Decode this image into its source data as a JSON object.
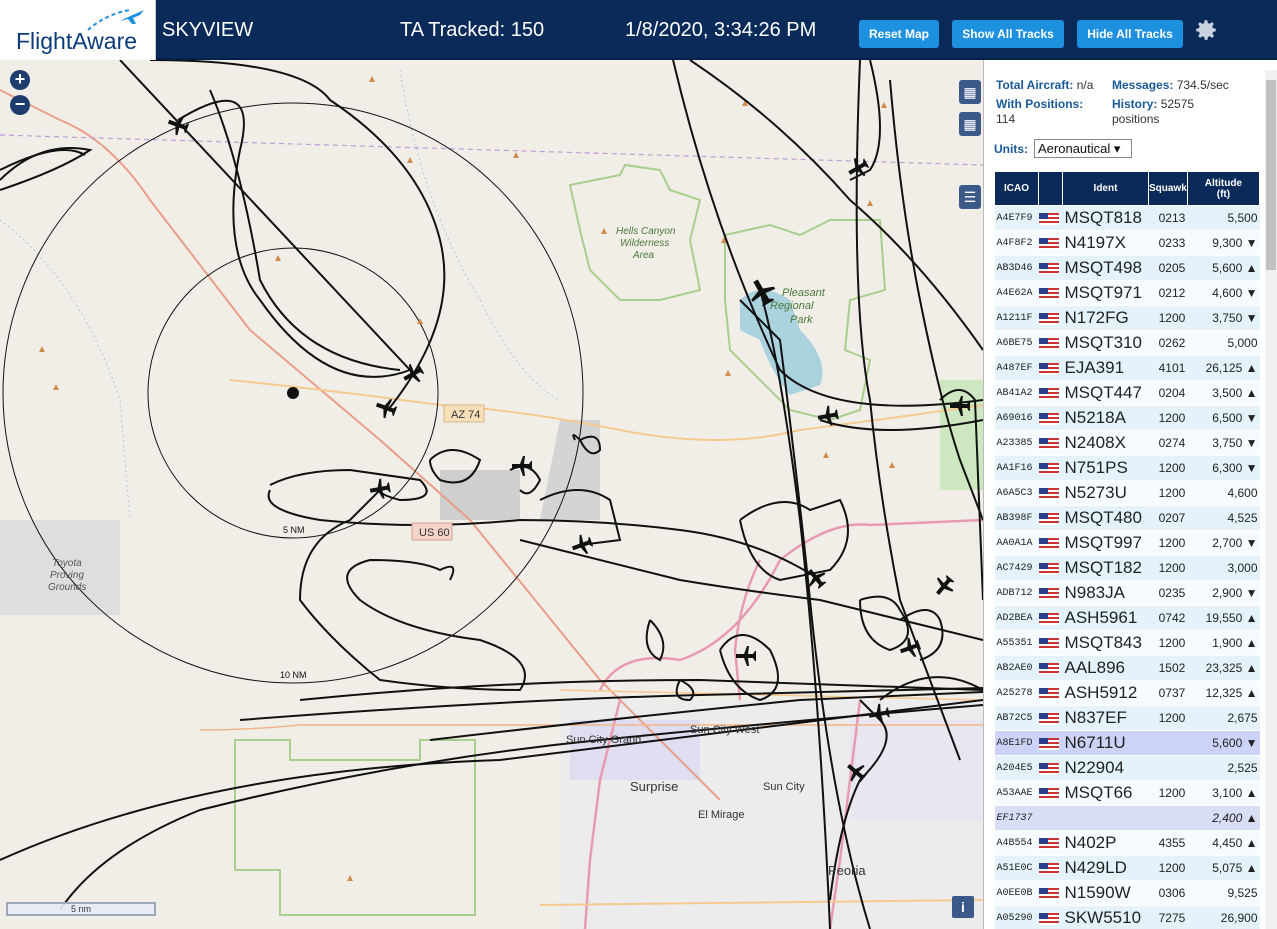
{
  "header": {
    "brand": "FlightAware",
    "app": "SKYVIEW",
    "tracked": "TA Tracked: 150",
    "datetime": "1/8/2020, 3:34:26 PM",
    "buttons": {
      "reset": "Reset Map",
      "show": "Show All Tracks",
      "hide": "Hide All Tracks"
    },
    "settings_icon": "gear-icon"
  },
  "map": {
    "labels": {
      "hells": "Hells Canyon",
      "wilderness": "Wilderness",
      "area": "Area",
      "pleasant": "Pleasant",
      "regional": "Regional",
      "park": "Park",
      "az74": "AZ 74",
      "us60": "US 60",
      "toyota": "Toyota",
      "proving": "Proving",
      "grounds": "Grounds",
      "suncitygrand": "Sun City Grand",
      "suncitywest": "Sun City West",
      "suncity": "Sun City",
      "surprise": "Surprise",
      "elmirage": "El Mirage",
      "peoria": "Peoria",
      "nm5": "5 NM",
      "nm10": "10 NM"
    },
    "scale": "5 nm",
    "zoom_in": "+",
    "zoom_out": "−",
    "info": "i"
  },
  "panel": {
    "total_label": "Total Aircraft:",
    "total_value": "n/a",
    "msg_label": "Messages:",
    "msg_value": "734.5/sec",
    "withpos_label": "With Positions:",
    "withpos_value": "114",
    "history_label": "History:",
    "history_value": "52575",
    "history_unit": "positions",
    "units_label": "Units:",
    "units_value": "Aeronautical ▾",
    "columns": {
      "icao": "ICAO",
      "ident": "Ident",
      "squawk": "Squawk",
      "alt1": "Altitude",
      "alt2": "(ft)"
    },
    "rows": [
      {
        "icao": "A4E7F9",
        "ident": "MSQT818",
        "sq": "0213",
        "alt": "5,500"
      },
      {
        "icao": "A4F8F2",
        "ident": "N4197X",
        "sq": "0233",
        "alt": "9,300 ▼"
      },
      {
        "icao": "AB3D46",
        "ident": "MSQT498",
        "sq": "0205",
        "alt": "5,600 ▲"
      },
      {
        "icao": "A4E62A",
        "ident": "MSQT971",
        "sq": "0212",
        "alt": "4,600 ▼"
      },
      {
        "icao": "A1211F",
        "ident": "N172FG",
        "sq": "1200",
        "alt": "3,750 ▼"
      },
      {
        "icao": "A6BE75",
        "ident": "MSQT310",
        "sq": "0262",
        "alt": "5,000"
      },
      {
        "icao": "A487EF",
        "ident": "EJA391",
        "sq": "4101",
        "alt": "26,125 ▲"
      },
      {
        "icao": "AB41A2",
        "ident": "MSQT447",
        "sq": "0204",
        "alt": "3,500 ▲"
      },
      {
        "icao": "A69016",
        "ident": "N5218A",
        "sq": "1200",
        "alt": "6,500 ▼"
      },
      {
        "icao": "A23385",
        "ident": "N2408X",
        "sq": "0274",
        "alt": "3,750 ▼"
      },
      {
        "icao": "AA1F16",
        "ident": "N751PS",
        "sq": "1200",
        "alt": "6,300 ▼"
      },
      {
        "icao": "A6A5C3",
        "ident": "N5273U",
        "sq": "1200",
        "alt": "4,600"
      },
      {
        "icao": "AB398F",
        "ident": "MSQT480",
        "sq": "0207",
        "alt": "4,525"
      },
      {
        "icao": "AA0A1A",
        "ident": "MSQT997",
        "sq": "1200",
        "alt": "2,700 ▼"
      },
      {
        "icao": "AC7429",
        "ident": "MSQT182",
        "sq": "1200",
        "alt": "3,000"
      },
      {
        "icao": "ADB712",
        "ident": "N983JA",
        "sq": "0235",
        "alt": "2,900 ▼"
      },
      {
        "icao": "AD2BEA",
        "ident": "ASH5961",
        "sq": "0742",
        "alt": "19,550 ▲"
      },
      {
        "icao": "A55351",
        "ident": "MSQT843",
        "sq": "1200",
        "alt": "1,900 ▲"
      },
      {
        "icao": "AB2AE0",
        "ident": "AAL896",
        "sq": "1502",
        "alt": "23,325 ▲"
      },
      {
        "icao": "A25278",
        "ident": "ASH5912",
        "sq": "0737",
        "alt": "12,325 ▲"
      },
      {
        "icao": "AB72C5",
        "ident": "N837EF",
        "sq": "1200",
        "alt": "2,675"
      },
      {
        "icao": "A8E1FD",
        "ident": "N6711U",
        "sq": "",
        "alt": "5,600 ▼",
        "sel": true
      },
      {
        "icao": "A204E5",
        "ident": "N22904",
        "sq": "",
        "alt": "2,525"
      },
      {
        "icao": "A53AAE",
        "ident": "MSQT66",
        "sq": "1200",
        "alt": "3,100 ▲"
      },
      {
        "icao": "EF1737",
        "ident": "",
        "sq": "",
        "alt": "2,400 ▲",
        "grey": true,
        "noflag": true
      },
      {
        "icao": "A4B554",
        "ident": "N402P",
        "sq": "4355",
        "alt": "4,450 ▲"
      },
      {
        "icao": "A51E0C",
        "ident": "N429LD",
        "sq": "1200",
        "alt": "5,075 ▲"
      },
      {
        "icao": "A0EE0B",
        "ident": "N1590W",
        "sq": "0306",
        "alt": "9,525"
      },
      {
        "icao": "A05290",
        "ident": "SKW5510",
        "sq": "7275",
        "alt": "26,900"
      }
    ]
  }
}
